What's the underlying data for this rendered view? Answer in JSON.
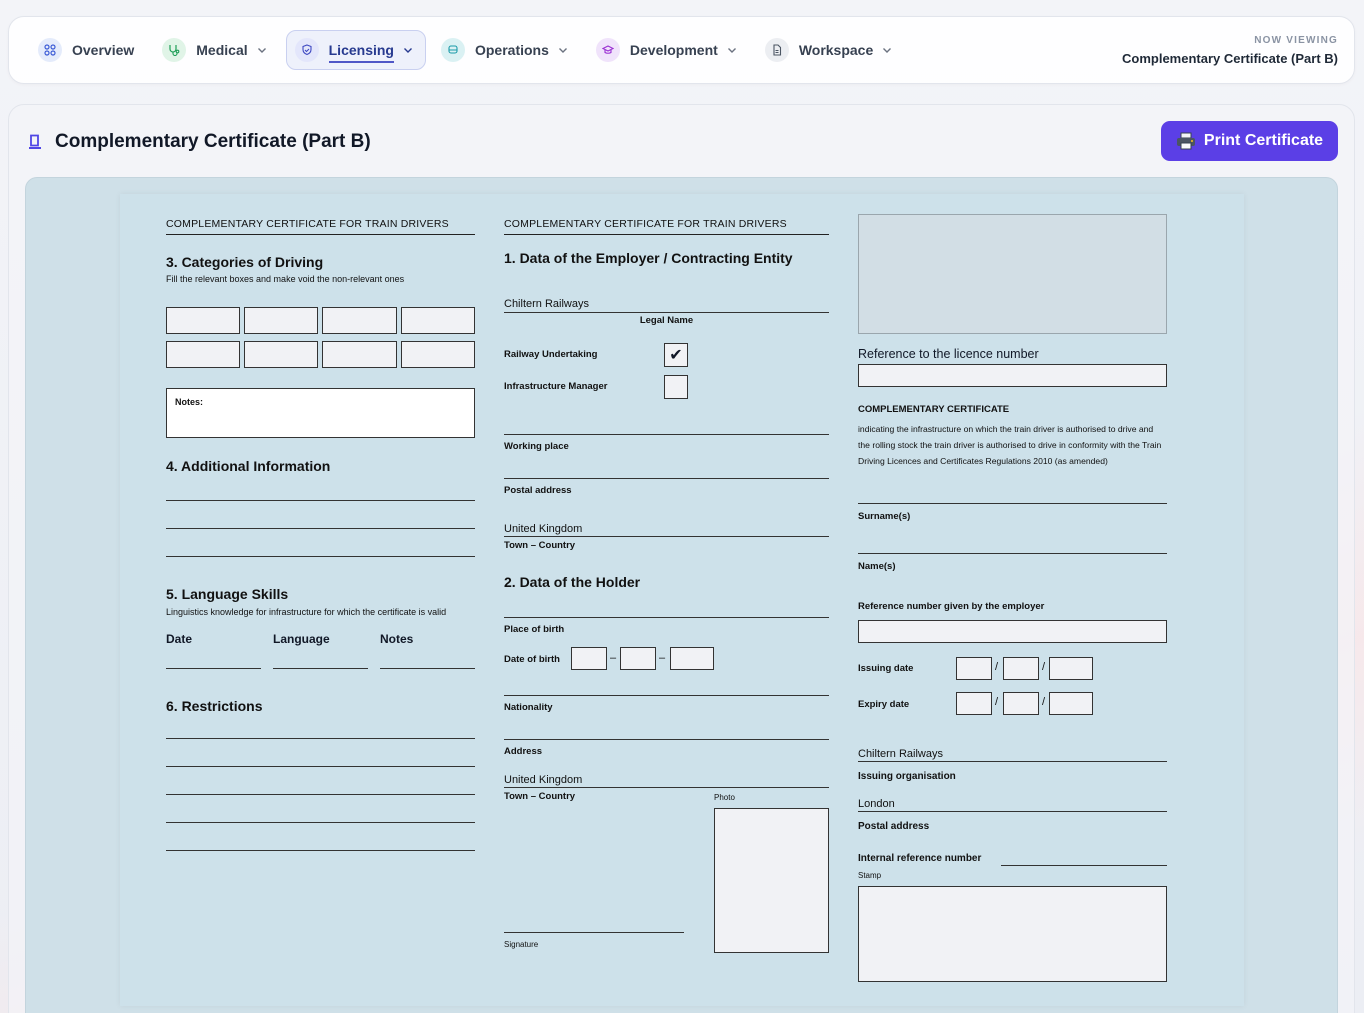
{
  "nav": {
    "items": [
      {
        "label": "Overview",
        "icon": "grid-icon",
        "color": "#dbe4ff"
      },
      {
        "label": "Medical",
        "icon": "stethoscope-icon",
        "color": "#dff5e6"
      },
      {
        "label": "Licensing",
        "icon": "shield-icon",
        "color": "#e3e6fb"
      },
      {
        "label": "Operations",
        "icon": "train-icon",
        "color": "#daf1f3"
      },
      {
        "label": "Development",
        "icon": "graduation-cap-icon",
        "color": "#f0e3fb"
      },
      {
        "label": "Workspace",
        "icon": "document-icon",
        "color": "#eceef2"
      }
    ],
    "active": "Licensing",
    "now_viewing_label": "NOW VIEWING",
    "now_viewing_value": "Complementary Certificate (Part B)"
  },
  "page": {
    "title": "Complementary Certificate (Part B)",
    "print_label": "Print Certificate",
    "accent": "#5b3fe6"
  },
  "left": {
    "header": "COMPLEMENTARY CERTIFICATE FOR TRAIN DRIVERS",
    "sec3_title": "3. Categories of Driving",
    "sec3_sub": "Fill the relevant boxes and make void the non-relevant ones",
    "notes_label": "Notes:",
    "sec4_title": "4. Additional Information",
    "sec5_title": "5. Language Skills",
    "sec5_sub": "Linguistics knowledge for infrastructure for which the certificate is valid",
    "lang_cols": [
      "Date",
      "Language",
      "Notes"
    ],
    "sec6_title": "6. Restrictions"
  },
  "middle": {
    "header": "COMPLEMENTARY CERTIFICATE FOR TRAIN DRIVERS",
    "sec1_title": "1. Data of the Employer / Contracting Entity",
    "employer_name": "Chiltern Railways",
    "legal_name_label": "Legal Name",
    "railway_undertaking_label": "Railway Undertaking",
    "railway_undertaking_checked": true,
    "infrastructure_manager_label": "Infrastructure Manager",
    "infrastructure_manager_checked": false,
    "working_place_label": "Working place",
    "postal_address_label": "Postal address",
    "country_value": "United Kingdom",
    "town_country_label": "Town – Country",
    "sec2_title": "2. Data of the Holder",
    "place_of_birth_label": "Place of birth",
    "date_of_birth_label": "Date of birth",
    "nationality_label": "Nationality",
    "address_label": "Address",
    "holder_country_value": "United Kingdom",
    "holder_town_country_label": "Town – Country",
    "photo_label": "Photo",
    "signature_label": "Signature",
    "check_mark": "✔",
    "dash": "–"
  },
  "right": {
    "licence_ref_label": "Reference to the licence number",
    "cc_title": "COMPLEMENTARY CERTIFICATE",
    "cc_desc": "indicating the infrastructure on which the train driver is authorised to drive and the rolling stock the train driver is authorised to drive in conformity with the Train Driving Licences and Certificates Regulations 2010 (as amended)",
    "surname_label": "Surname(s)",
    "names_label": "Name(s)",
    "employer_ref_label": "Reference number given by the employer",
    "issuing_date_label": "Issuing date",
    "expiry_date_label": "Expiry date",
    "slash": "/",
    "issuing_org_value": "Chiltern Railways",
    "issuing_org_label": "Issuing organisation",
    "postal_value": "London",
    "postal_label": "Postal address",
    "internal_ref_label": "Internal reference number",
    "stamp_label": "Stamp"
  }
}
